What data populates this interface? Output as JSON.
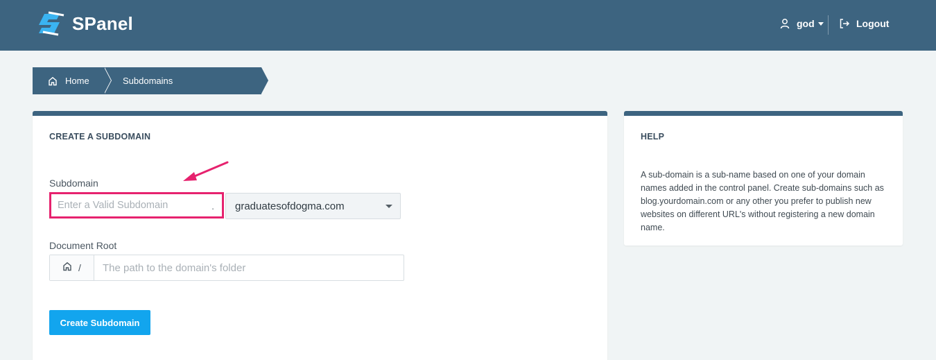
{
  "app": {
    "brand_name": "SPanel",
    "colors": {
      "header": "#3d6480",
      "accent_button": "#12a5ee",
      "highlight": "#e6226e"
    }
  },
  "header": {
    "user_name": "god",
    "logout_label": "Logout"
  },
  "breadcrumb": {
    "home_label": "Home",
    "current_label": "Subdomains"
  },
  "create_card": {
    "title": "CREATE A SUBDOMAIN",
    "subdomain_label": "Subdomain",
    "subdomain_placeholder": "Enter a Valid Subdomain",
    "subdomain_value": "",
    "separator": ".",
    "domain_selected": "graduatesofdogma.com",
    "docroot_label": "Document Root",
    "docroot_prefix": "/",
    "docroot_placeholder": "The path to the domain's folder",
    "docroot_value": "",
    "submit_label": "Create Subdomain"
  },
  "help_card": {
    "title": "HELP",
    "text": "A sub-domain is a sub-name based on one of your domain names added in the control panel. Create sub-domains such as blog.yourdomain.com or any other you prefer to publish new websites on different URL's without registering a new domain name."
  },
  "icons": {
    "logo": "spanel-logo-icon",
    "user": "user-icon",
    "logout": "logout-icon",
    "home": "home-icon",
    "annotation": "pink-arrow-icon"
  }
}
